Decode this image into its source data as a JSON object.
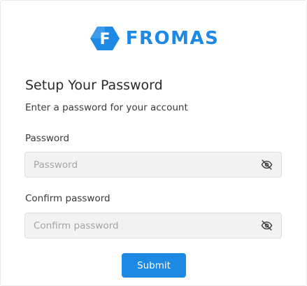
{
  "brand": {
    "name": "FROMAS",
    "logo_letter": "F",
    "logo_icon": "hexagon-f-logo",
    "color": "#1e88e5"
  },
  "form": {
    "title": "Setup Your Password",
    "subtitle": "Enter a password for your account",
    "password": {
      "label": "Password",
      "placeholder": "Password",
      "value": "",
      "toggle_icon": "eye-slash-icon"
    },
    "confirm": {
      "label": "Confirm password",
      "placeholder": "Confirm password",
      "value": "",
      "toggle_icon": "eye-slash-icon"
    },
    "submit_label": "Submit",
    "accent_color": "#1e88e5"
  }
}
